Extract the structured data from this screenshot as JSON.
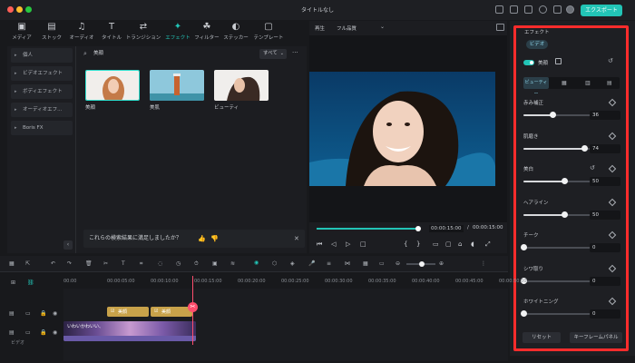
{
  "app": {
    "title": "タイトルなし",
    "export_label": "エクスポート"
  },
  "asset_tabs": [
    {
      "label": "メディア",
      "icon": "media-icon",
      "glyph": "▣"
    },
    {
      "label": "ストック",
      "icon": "stock-icon",
      "glyph": "▤"
    },
    {
      "label": "オーディオ",
      "icon": "audio-icon",
      "glyph": "♫"
    },
    {
      "label": "タイトル",
      "icon": "title-icon",
      "glyph": "T"
    },
    {
      "label": "トランジション",
      "icon": "transition-icon",
      "glyph": "⇄"
    },
    {
      "label": "エフェクト",
      "icon": "effect-icon",
      "glyph": "✦"
    },
    {
      "label": "フィルター",
      "icon": "filter-icon",
      "glyph": "☘"
    },
    {
      "label": "ステッカー",
      "icon": "sticker-icon",
      "glyph": "◐"
    },
    {
      "label": "テンプレート",
      "icon": "template-icon",
      "glyph": "▢"
    }
  ],
  "categories": [
    "個人",
    "ビデオエフェクト",
    "ボディエフェクト",
    "オーディオエフ...",
    "Boris FX"
  ],
  "search": {
    "value": "美顔"
  },
  "filter_dropdown": "すべて",
  "effects": [
    {
      "label": "美顔"
    },
    {
      "label": "美肌"
    },
    {
      "label": "ビューティ"
    }
  ],
  "feedback": {
    "question": "これらの検索結果に満足しましたか？"
  },
  "preview": {
    "play_label": "再生",
    "quality": "フル品質",
    "time_current": "00:00:15:00",
    "time_separator": "/",
    "time_total": "00:00:15:00",
    "progress": 1.0
  },
  "inspector": {
    "tab": "エフェクト",
    "subtab": "ビデオ",
    "effect_name": "美顔",
    "mode_tab": "ビューティー",
    "params": [
      {
        "label": "赤み補正",
        "value": "36",
        "level": 0.36
      },
      {
        "label": "肌磨き",
        "value": "74",
        "level": 0.74
      },
      {
        "label": "美白",
        "value": "50",
        "level": 0.5
      },
      {
        "label": "ヘアライン",
        "value": "50",
        "level": 0.5
      },
      {
        "label": "チーク",
        "value": "0",
        "level": 0.0
      },
      {
        "label": "シワ取り",
        "value": "0",
        "level": 0.0
      },
      {
        "label": "ホワイトニング",
        "value": "0",
        "level": 0.0
      }
    ],
    "reset_label": "リセット",
    "keyframe_label": "キーフレームパネル"
  },
  "timeline": {
    "ruler": [
      "00:00",
      "00:00:05:00",
      "00:00:10:00",
      "00:00:15:00",
      "00:00:20:00",
      "00:00:25:00",
      "00:00:30:00",
      "00:00:35:00",
      "00:00:40:00",
      "00:00:45:00",
      "00:00:50:00"
    ],
    "effect_clips": [
      {
        "label": "美顔"
      },
      {
        "label": "美顔"
      }
    ],
    "video_clip_label": "いわいかわいい、",
    "track_label": "ビデオ"
  },
  "colors": {
    "accent": "#22c4b6",
    "highlight": "#ff2c2c",
    "playhead": "#ff4d6d",
    "effect_clip": "#c8a24a"
  }
}
